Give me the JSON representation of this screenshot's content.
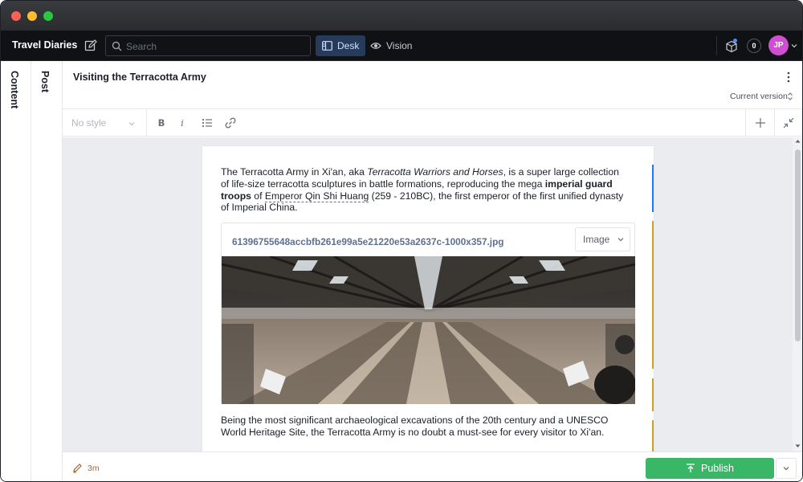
{
  "app": {
    "title": "Travel Diaries",
    "search_placeholder": "Search",
    "tools": [
      {
        "label": "Desk",
        "icon": "desk-icon",
        "active": true
      },
      {
        "label": "Vision",
        "icon": "eye-icon",
        "active": false
      }
    ],
    "notification_count": "0",
    "user_initials": "JP"
  },
  "rails": {
    "content_label": "Content",
    "post_label": "Post"
  },
  "document": {
    "title": "Visiting the Terracotta Army",
    "version_label": "Current version",
    "style_placeholder": "No style",
    "toolbar": {
      "bold": "B",
      "italic": "i"
    },
    "paragraph1": {
      "text1": "The Terracotta Army in Xi'an, aka ",
      "italic": "Terracotta Warriors and Horses",
      "text2": ", is a super large collection of life-size terracotta sculptures in battle formations, reproducing the mega ",
      "bold": "imperial guard troops",
      "text3": " of ",
      "link": "Emperor Qin Shi Huang",
      "text4": " (259 - 210BC), the first emperor of the first unified dynasty of Imperial China."
    },
    "image_block": {
      "filename": "61396755648accbfb261e99a5e21220e53a2637c-1000x357.jpg",
      "type_label": "Image"
    },
    "paragraph2": "Being the most significant archaeological excavations of the 20th century and a UNESCO World Heritage Site, the Terracotta Army is no doubt a must-see for every visitor to Xi'an."
  },
  "footer": {
    "edited_ago": "3m",
    "publish_label": "Publish"
  },
  "colors": {
    "accent_blue": "#2276fc",
    "publish_green": "#3ab667",
    "avatar_purple": "#cf4fd0",
    "change_marker_yellow": "#c9a227"
  }
}
